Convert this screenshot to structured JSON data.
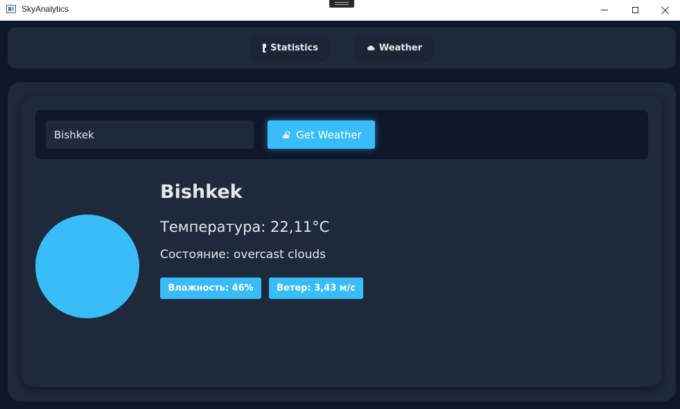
{
  "window": {
    "title": "SkyAnalytics"
  },
  "nav": {
    "statistics_label": "Statistics",
    "statistics_icon": "statistics-icon",
    "weather_label": "Weather",
    "weather_icon": "cloud-icon"
  },
  "search": {
    "city_value": "Bishkek",
    "button_label": "Get Weather",
    "button_icon": "cloud-sun-icon"
  },
  "weather": {
    "city": "Bishkek",
    "temperature": "Температура: 22,11°C",
    "condition": "Состояние: overcast clouds",
    "humidity": "Влажность: 46%",
    "wind": "Ветер: 3,43 м/с"
  },
  "colors": {
    "background": "#0f172a",
    "panel": "#1e293b",
    "accent": "#38bdf8",
    "text": "#e2e8f0"
  }
}
